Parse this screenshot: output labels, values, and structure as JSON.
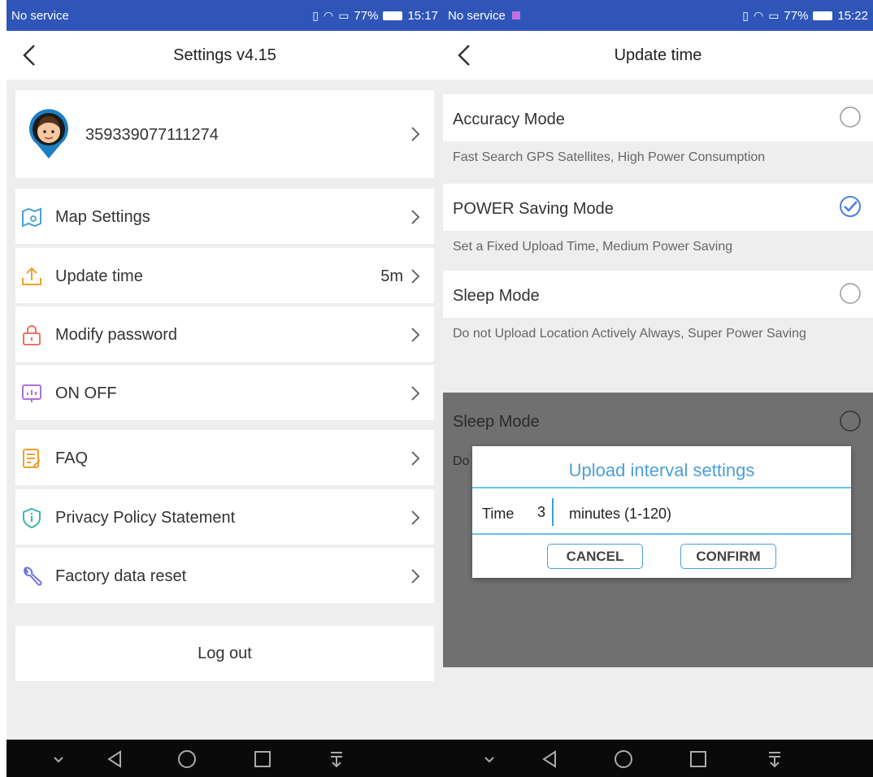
{
  "left": {
    "status": {
      "carrier": "No service",
      "battery": "77%",
      "time": "15:17"
    },
    "title": "Settings v4.15",
    "device_id": "359339077111274",
    "menu": [
      {
        "label": "Map Settings",
        "value": "",
        "icon": "map-icon"
      },
      {
        "label": "Update time",
        "value": "5m",
        "icon": "upload-icon"
      },
      {
        "label": "Modify password",
        "value": "",
        "icon": "lock-icon"
      },
      {
        "label": "ON OFF",
        "value": "",
        "icon": "monitor-icon"
      },
      {
        "label": "FAQ",
        "value": "",
        "icon": "faq-icon"
      },
      {
        "label": "Privacy Policy Statement",
        "value": "",
        "icon": "shield-icon"
      },
      {
        "label": "Factory data reset",
        "value": "",
        "icon": "wrench-icon"
      }
    ],
    "logout": "Log out"
  },
  "right": {
    "status": {
      "carrier": "No service",
      "battery": "77%",
      "time": "15:22"
    },
    "title": "Update time",
    "modes": [
      {
        "label": "Accuracy Mode",
        "desc": "Fast Search GPS Satellites, High Power Consumption",
        "selected": false
      },
      {
        "label": "POWER Saving Mode",
        "desc": "Set a Fixed Upload Time, Medium Power Saving",
        "selected": true
      },
      {
        "label": "Sleep Mode",
        "desc": "Do not Upload Location Actively Always, Super Power Saving",
        "selected": false
      }
    ],
    "overlay": {
      "mode_label": "Sleep Mode",
      "desc_peek": "Do"
    },
    "dialog": {
      "title": "Upload interval settings",
      "time_label": "Time",
      "time_value": "3",
      "unit_label": "minutes (1-120)",
      "cancel": "CANCEL",
      "confirm": "CONFIRM"
    }
  },
  "colors": {
    "status_bar": "#2f55b8",
    "accent": "#4aa0d8",
    "background": "#eeeeee",
    "overlay": "#707070"
  }
}
